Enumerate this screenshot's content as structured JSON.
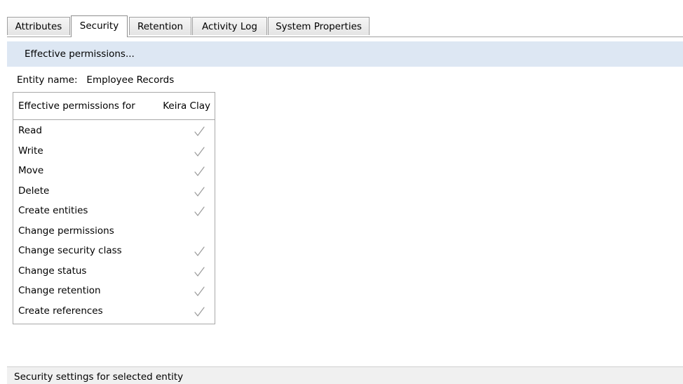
{
  "tabs": [
    {
      "label": "Attributes",
      "active": false
    },
    {
      "label": "Security",
      "active": true
    },
    {
      "label": "Retention",
      "active": false
    },
    {
      "label": "Activity Log",
      "active": false
    },
    {
      "label": "System Properties",
      "active": false
    }
  ],
  "toolbar": {
    "effective_permissions_label": "Effective permissions..."
  },
  "entity": {
    "label": "Entity name:",
    "name": "Employee Records"
  },
  "permissions": {
    "header_label": "Effective permissions for",
    "user": "Keira Clay",
    "items": [
      {
        "label": "Read",
        "granted": true
      },
      {
        "label": "Write",
        "granted": true
      },
      {
        "label": "Move",
        "granted": true
      },
      {
        "label": "Delete",
        "granted": true
      },
      {
        "label": "Create entities",
        "granted": true
      },
      {
        "label": "Change permissions",
        "granted": false
      },
      {
        "label": "Change security class",
        "granted": true
      },
      {
        "label": "Change status",
        "granted": true
      },
      {
        "label": "Change retention",
        "granted": true
      },
      {
        "label": "Create references",
        "granted": true
      }
    ],
    "check_icon": "checkmark-icon",
    "check_color": "#9a9a9a"
  },
  "status": {
    "text": "Security settings for selected entity"
  },
  "colors": {
    "toolbar_bg": "#dde7f3",
    "tab_border": "#a0a0a0"
  }
}
